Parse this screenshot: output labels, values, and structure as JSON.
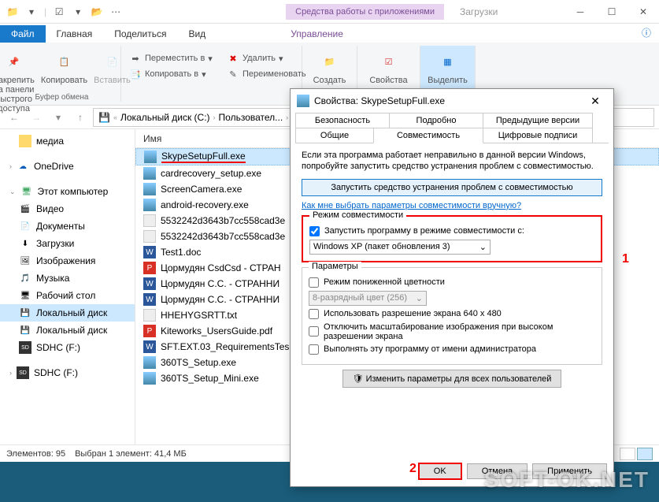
{
  "titlebar": {
    "context_tab": "Средства работы с приложениями",
    "path_hint": "Загрузки"
  },
  "ribbon": {
    "file": "Файл",
    "tabs": [
      "Главная",
      "Поделиться",
      "Вид"
    ],
    "context_tab": "Управление",
    "pin": "Закрепить на панели\nбыстрого доступа",
    "copy": "Копировать",
    "paste": "Вставить",
    "group_clipboard": "Буфер обмена",
    "move_to": "Переместить в",
    "copy_to": "Копировать в",
    "delete": "Удалить",
    "rename": "Переименовать",
    "new": "Создать",
    "properties": "Свойства",
    "select": "Выделить"
  },
  "address": {
    "crumbs": [
      "Локальный диск (C:)",
      "Пользовател..."
    ]
  },
  "nav": {
    "media": "медиа",
    "onedrive": "OneDrive",
    "this_pc": "Этот компьютер",
    "items": [
      "Видео",
      "Документы",
      "Загрузки",
      "Изображения",
      "Музыка",
      "Рабочий стол",
      "Локальный диск",
      "Локальный диск",
      "SDHC (F:)"
    ],
    "sdhc": "SDHC (F:)"
  },
  "files": {
    "column": "Имя",
    "list": [
      "SkypeSetupFull.exe",
      "cardrecovery_setup.exe",
      "ScreenCamera.exe",
      "android-recovery.exe",
      "5532242d3643b7cc558cad3e",
      "5532242d3643b7cc558cad3e",
      "Test1.doc",
      "Цормудян CsdCsd - СТРАН",
      "Цормудян С.С. - СТРАННИ",
      "Цормудян С.С. - СТРАННИ",
      "HHEHYGSRTT.txt",
      "Kiteworks_UsersGuide.pdf",
      "SFT.EXT.03_RequirementsTes",
      "360TS_Setup.exe",
      "360TS_Setup_Mini.exe"
    ]
  },
  "status": {
    "count": "Элементов: 95",
    "sel": "Выбран 1 элемент: 41,4 МБ"
  },
  "dialog": {
    "title": "Свойства: SkypeSetupFull.exe",
    "tabs_row1": [
      "Безопасность",
      "Подробно",
      "Предыдущие версии"
    ],
    "tabs_row2": [
      "Общие",
      "Совместимость",
      "Цифровые подписи"
    ],
    "desc": "Если эта программа работает неправильно в данной версии Windows, попробуйте запустить средство устранения проблем с совместимостью.",
    "troubleshoot": "Запустить средство устранения проблем с совместимостью",
    "manual_link": "Как мне выбрать параметры совместимости вручную?",
    "compat_legend": "Режим совместимости",
    "compat_check": "Запустить программу в режиме совместимости с:",
    "compat_value": "Windows XP (пакет обновления 3)",
    "params_legend": "Параметры",
    "reduced_color": "Режим пониженной цветности",
    "color_mode": "8-разрядный цвет (256)",
    "res640": "Использовать разрешение экрана 640 x 480",
    "disable_scaling": "Отключить масштабирование изображения при высоком разрешении экрана",
    "run_admin": "Выполнять эту программу от имени администратора",
    "change_all": "Изменить параметры для всех пользователей",
    "ok": "OK",
    "cancel": "Отмена",
    "apply": "Применить"
  },
  "annotations": {
    "one": "1",
    "two": "2"
  },
  "watermark": "SOFT-OK.NET"
}
